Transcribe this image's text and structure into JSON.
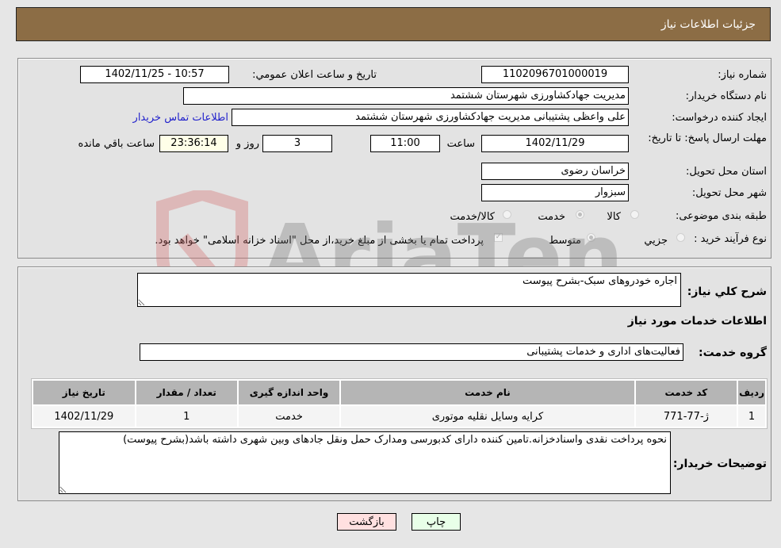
{
  "header": {
    "title": "جزئیات اطلاعات نیاز"
  },
  "form": {
    "need_number": {
      "label": "شماره نیاز:",
      "value": "1102096701000019"
    },
    "announce_datetime": {
      "label": "تاریخ و ساعت اعلان عمومي:",
      "value": "1402/11/25 - 10:57"
    },
    "buyer_org": {
      "label": "نام دستگاه خریدار:",
      "value": "مدیریت جهادکشاورزی شهرستان ششتمد"
    },
    "requester": {
      "label": "ایجاد کننده درخواست:",
      "value": "علی واعظی پشتیبانی مدیریت جهادکشاورزی شهرستان ششتمد"
    },
    "buyer_contact_link": "اطلاعات تماس خریدار",
    "deadline": {
      "label": "مهلت ارسال پاسخ: تا تاریخ:",
      "date": "1402/11/29",
      "time_label": "ساعت",
      "time": "11:00",
      "days": "3",
      "days_label": "روز و",
      "remaining": "23:36:14",
      "remaining_label": "ساعت باقي مانده"
    },
    "province": {
      "label": "استان محل تحویل:",
      "value": "خراسان رضوی"
    },
    "city": {
      "label": "شهر محل تحویل:",
      "value": "سبزوار"
    },
    "category": {
      "label": "طبقه بندی موضوعی:",
      "options": [
        "کالا",
        "خدمت",
        "کالا/خدمت"
      ],
      "selected": "خدمت"
    },
    "purchase_type": {
      "label": "نوع فرآیند خرید :",
      "options": [
        "جزيي",
        "متوسط"
      ],
      "selected": "متوسط",
      "treasury_note": "پرداخت تمام یا بخشی از مبلغ خرید،از محل \"اسناد خزانه اسلامی\" خواهد بود.",
      "treasury_checked": true
    }
  },
  "details": {
    "summary_label": "شرح کلي نياز:",
    "summary_value": "اجاره خودروهای سبک-بشرح پیوست",
    "services_heading": "اطلاعات خدمات مورد نياز",
    "service_group_label": "گروه خدمت:",
    "service_group_value": "فعالیت‌های اداری و خدمات پشتیبانی",
    "table": {
      "headers": [
        "رديف",
        "کد خدمت",
        "نام خدمت",
        "واحد اندازه گیری",
        "تعداد / مقدار",
        "تاریخ نیاز"
      ],
      "rows": [
        [
          "1",
          "ژ-77-771",
          "کرایه وسایل نقلیه موتوری",
          "خدمت",
          "1",
          "1402/11/29"
        ]
      ]
    },
    "buyer_notes_label": "توضیحات خریدار:",
    "buyer_notes_value": "نحوه پرداخت نقدی واسنادخزانه.تامین کننده دارای کدبورسی ومدارک حمل ونقل جادهای وبین شهری داشته باشد(بشرح پیوست)"
  },
  "buttons": {
    "print": "چاپ",
    "back": "بازگشت"
  },
  "watermark": "AriaTender.neT",
  "colors": {
    "header_bg": "#8c6d45",
    "back_button_bg": "#ffe0e0",
    "print_button_bg": "#e8ffe8",
    "link": "#2222cc"
  }
}
